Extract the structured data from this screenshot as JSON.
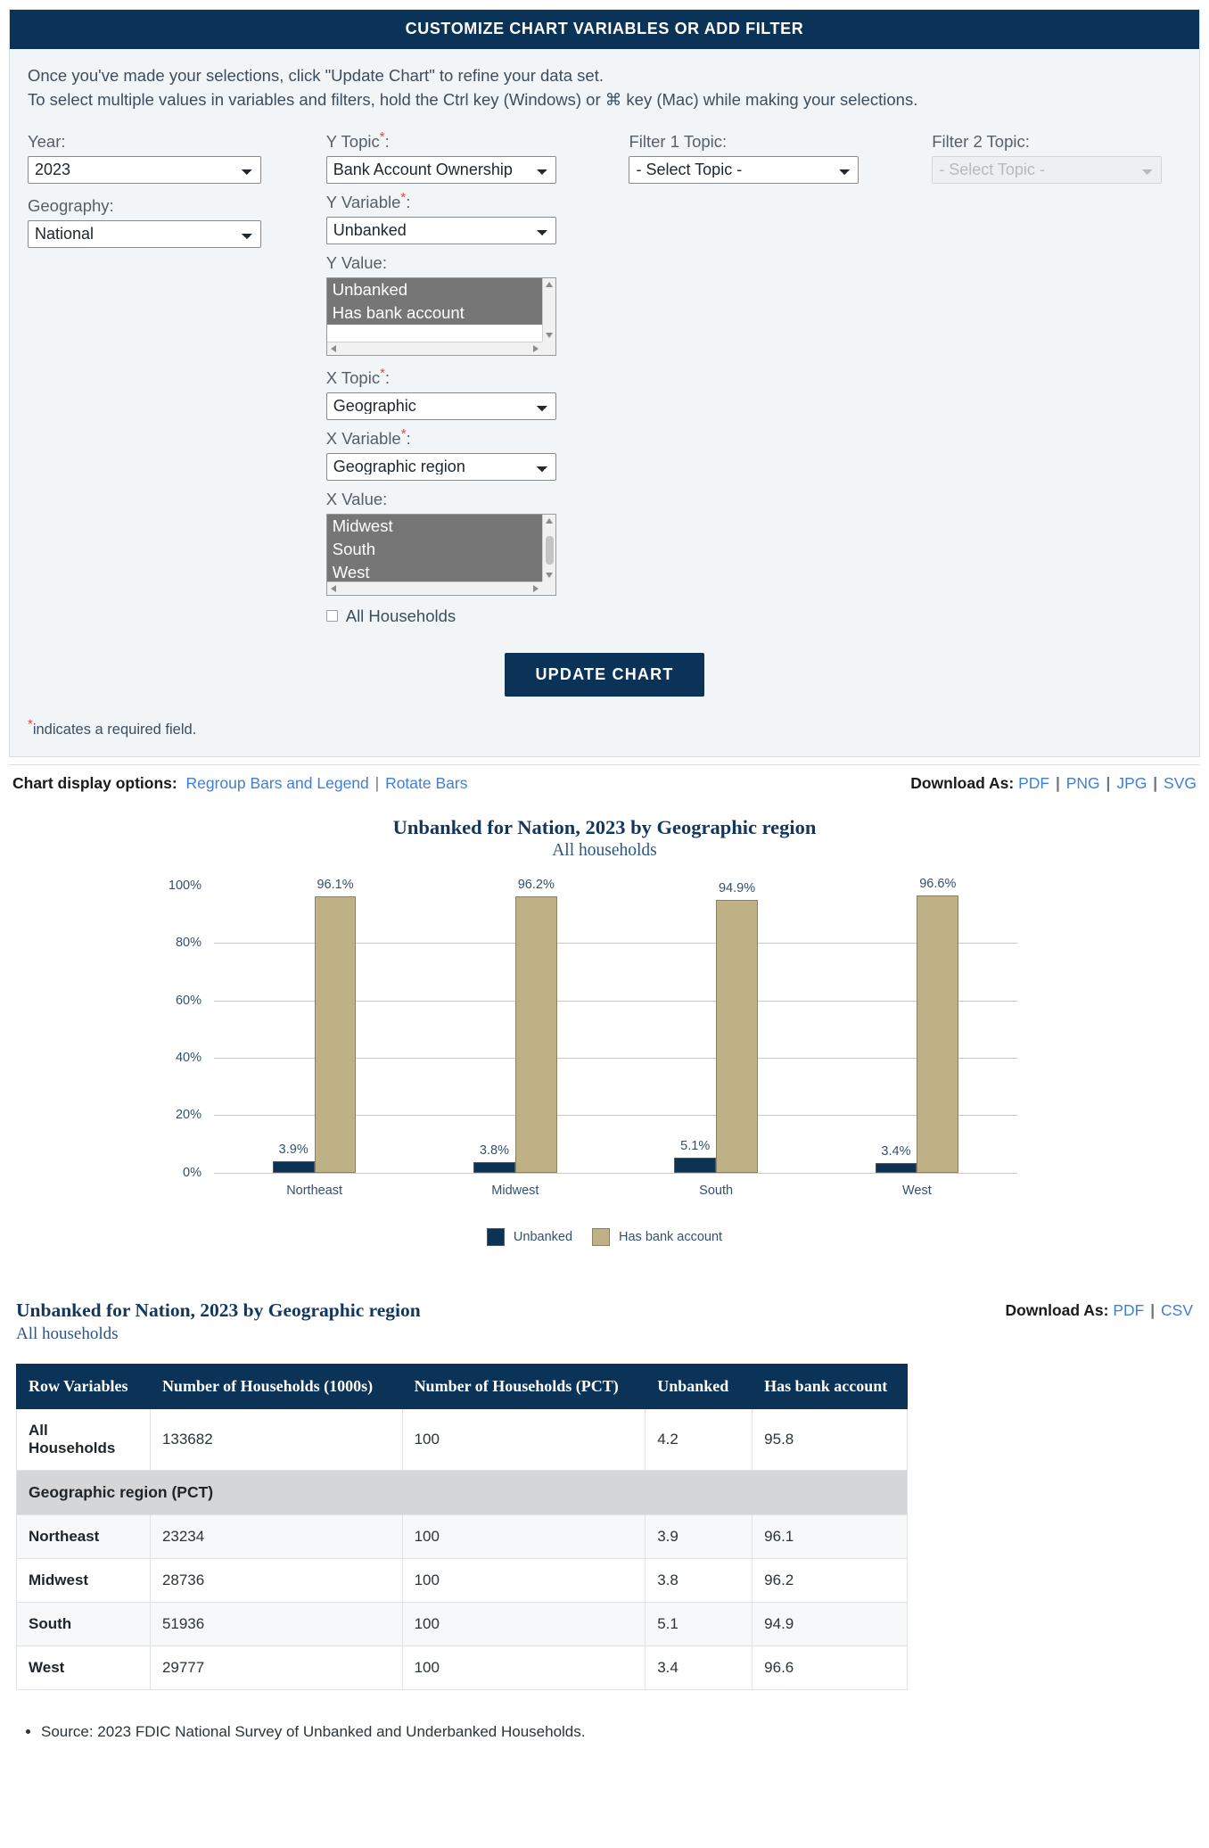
{
  "panel": {
    "header": "CUSTOMIZE CHART VARIABLES OR ADD FILTER",
    "intro_line1": "Once you've made your selections, click \"Update Chart\" to refine your data set.",
    "intro_line2": "To select multiple values in variables and filters, hold the Ctrl key (Windows) or ⌘ key (Mac) while making your selections.",
    "required_note": "indicates a required field.",
    "required_marker": "*",
    "update_button": "UPDATE CHART",
    "fields": {
      "year_label": "Year:",
      "year_value": "2023",
      "geography_label": "Geography:",
      "geography_value": "National",
      "y_topic_label": "Y Topic",
      "y_topic_value": "Bank Account Ownership",
      "y_variable_label": "Y Variable",
      "y_variable_value": "Unbanked",
      "y_value_label": "Y Value:",
      "y_values": [
        {
          "label": "Unbanked",
          "selected": true
        },
        {
          "label": "Has bank account",
          "selected": true
        }
      ],
      "x_topic_label": "X Topic",
      "x_topic_value": "Geographic",
      "x_variable_label": "X Variable",
      "x_variable_value": "Geographic region",
      "x_value_label": "X Value:",
      "x_values": [
        {
          "label": "Midwest",
          "selected": true
        },
        {
          "label": "South",
          "selected": true
        },
        {
          "label": "West",
          "selected": true
        }
      ],
      "all_households_label": "All Households",
      "all_households_checked": false,
      "filter1_label": "Filter 1 Topic:",
      "filter1_value": "- Select Topic -",
      "filter2_label": "Filter 2 Topic:",
      "filter2_value": "- Select Topic -",
      "filter2_disabled": true
    }
  },
  "options_bar": {
    "label": "Chart display options:",
    "regroup": "Regroup Bars and Legend",
    "rotate": "Rotate Bars",
    "separator": "|",
    "download_label": "Download As:",
    "formats": [
      "PDF",
      "PNG",
      "JPG",
      "SVG"
    ]
  },
  "chart_data": {
    "type": "bar",
    "title": "Unbanked for Nation, 2023 by Geographic region",
    "subtitle": "All households",
    "categories": [
      "Northeast",
      "Midwest",
      "South",
      "West"
    ],
    "series": [
      {
        "name": "Unbanked",
        "color": "#0d3354",
        "values": [
          3.9,
          3.8,
          5.1,
          3.4
        ],
        "labels": [
          "3.9%",
          "3.8%",
          "5.1%",
          "3.4%"
        ]
      },
      {
        "name": "Has bank account",
        "color": "#bdb185",
        "values": [
          96.1,
          96.2,
          94.9,
          96.6
        ],
        "labels": [
          "96.1%",
          "96.2%",
          "94.9%",
          "96.6%"
        ]
      }
    ],
    "ylim": [
      0,
      100
    ],
    "yticks": [
      0,
      20,
      40,
      60,
      80,
      100
    ],
    "ytick_labels": [
      "0%",
      "20%",
      "40%",
      "60%",
      "80%",
      "100%"
    ],
    "xlabel": "",
    "ylabel": "",
    "grid": true,
    "legend_position": "bottom"
  },
  "table_section": {
    "title": "Unbanked for Nation, 2023 by Geographic region",
    "subtitle": "All households",
    "download_label": "Download As:",
    "formats": [
      "PDF",
      "CSV"
    ],
    "separator": "|",
    "columns": [
      "Row Variables",
      "Number of Households (1000s)",
      "Number of Households (PCT)",
      "Unbanked",
      "Has bank account"
    ],
    "rows": [
      {
        "type": "data",
        "cells": [
          "All Households",
          "133682",
          "100",
          "4.2",
          "95.8"
        ]
      },
      {
        "type": "group",
        "cells": [
          "Geographic region (PCT)"
        ]
      },
      {
        "type": "data",
        "cells": [
          "Northeast",
          "23234",
          "100",
          "3.9",
          "96.1"
        ]
      },
      {
        "type": "data",
        "cells": [
          "Midwest",
          "28736",
          "100",
          "3.8",
          "96.2"
        ]
      },
      {
        "type": "data",
        "cells": [
          "South",
          "51936",
          "100",
          "5.1",
          "94.9"
        ]
      },
      {
        "type": "data",
        "cells": [
          "West",
          "29777",
          "100",
          "3.4",
          "96.6"
        ]
      }
    ]
  },
  "footer": {
    "source": "Source: 2023 FDIC National Survey of Unbanked and Underbanked Households."
  },
  "colors": {
    "brand_navy": "#0b3257",
    "unbanked": "#0d3354",
    "has_bank_account": "#bdb185",
    "link": "#3f7fd6",
    "panel_bg": "#f1f5f8"
  }
}
